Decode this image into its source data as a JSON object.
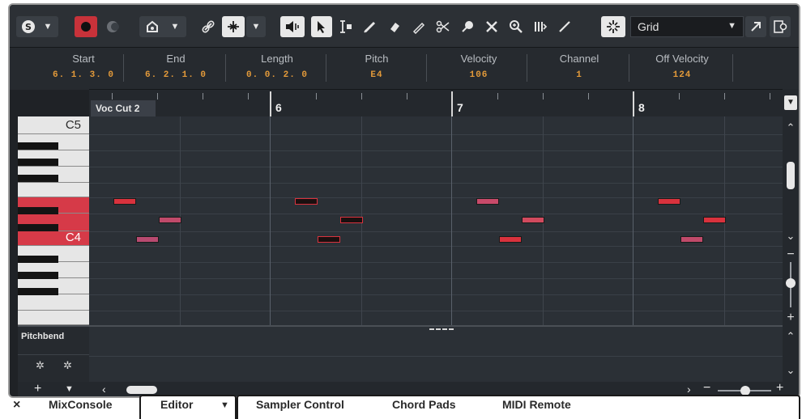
{
  "toolbar": {
    "icons": [
      "solo-icon",
      "dropdown",
      "record-icon",
      "monitor-icon",
      "midi-input-icon",
      "dropdown",
      "link-icon",
      "insert-mode-icon",
      "dropdown",
      "speaker-icon",
      "pointer-icon",
      "range-icon",
      "draw-icon",
      "erase-icon",
      "pencil-icon",
      "split-icon",
      "glue-icon",
      "mute-icon",
      "zoom-icon",
      "comp-icon",
      "line-icon",
      "snap-icon"
    ],
    "grid_label": "Grid"
  },
  "info_line": {
    "columns": [
      {
        "label": "Start",
        "value": "6. 1. 3.   0"
      },
      {
        "label": "End",
        "value": "6. 2. 1.   0"
      },
      {
        "label": "Length",
        "value": "0. 0. 2.   0"
      },
      {
        "label": "Pitch",
        "value": "E4"
      },
      {
        "label": "Velocity",
        "value": "106"
      },
      {
        "label": "Channel",
        "value": "1"
      },
      {
        "label": "Off Velocity",
        "value": "124"
      }
    ]
  },
  "ruler": {
    "part_name": "Voc Cut 2",
    "bars": [
      "6",
      "7",
      "8"
    ]
  },
  "keyboard": {
    "labels": [
      "C5",
      "C4"
    ]
  },
  "lane": {
    "title": "Pitchbend"
  },
  "tabs": {
    "close": "×",
    "items": [
      "MixConsole",
      "Editor",
      "Sampler Control",
      "Chord Pads",
      "MIDI Remote"
    ]
  },
  "colors": {
    "note_red": "#d9323d",
    "note_pink": "#c04a6a",
    "note_selected": "#1a1010",
    "accent_orange": "#e39a3a"
  }
}
